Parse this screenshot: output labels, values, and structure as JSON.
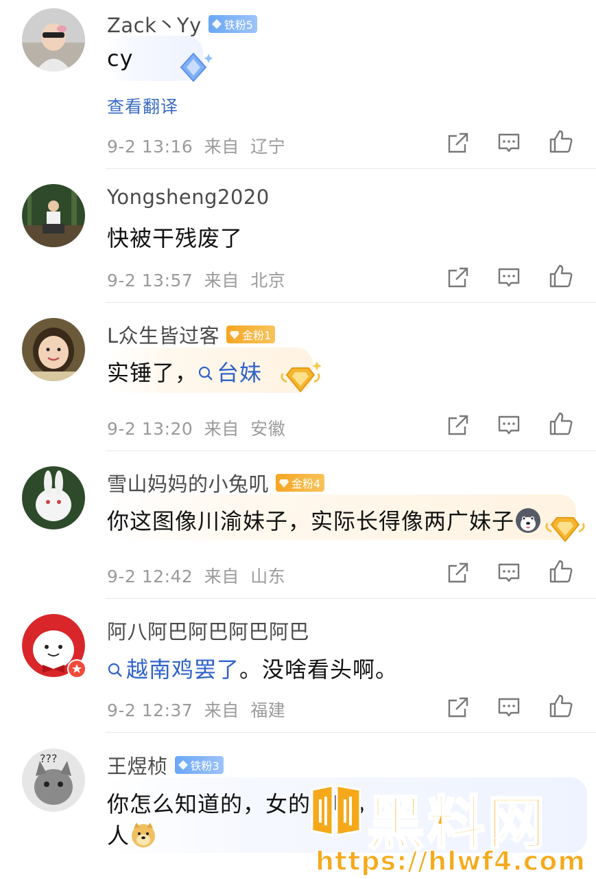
{
  "comments": [
    {
      "username": "Zack丶Yy",
      "badge": {
        "type": "iron",
        "label": "铁粉5"
      },
      "text": "cy",
      "translate": "查看翻译",
      "time": "9-2 13:16",
      "from": "来自",
      "location": "辽宁"
    },
    {
      "username": "Yongsheng2020",
      "text": "快被干残废了",
      "time": "9-2 13:57",
      "from": "来自",
      "location": "北京"
    },
    {
      "username": "L众生皆过客",
      "badge": {
        "type": "gold",
        "label": "金粉1"
      },
      "text": "实锤了，",
      "topic": "台妹",
      "time": "9-2 13:20",
      "from": "来自",
      "location": "安徽"
    },
    {
      "username": "雪山妈妈的小兔叽",
      "badge": {
        "type": "gold",
        "label": "金粉4"
      },
      "text": "你这图像川渝妹子，实际长得像两广妹子",
      "time": "9-2 12:42",
      "from": "来自",
      "location": "山东"
    },
    {
      "username": "阿八阿巴阿巴阿巴阿巴",
      "topic": "越南鸡罢了",
      "text": "。没啥看头啊。",
      "time": "9-2 12:37",
      "from": "来自",
      "location": "福建"
    },
    {
      "username": "王煜桢",
      "badge": {
        "type": "iron",
        "label": "铁粉3"
      },
      "text": "你怎么知道的，女的叫啥，",
      "text_line2": "人"
    }
  ],
  "watermark": {
    "brand": "黑料网",
    "url": "https://hlwf4.com"
  },
  "colors": {
    "topic": "#2f62c9",
    "meta": "#9a9a9a",
    "iron_badge": "#6aa7f5",
    "gold_badge": "#f5a623",
    "watermark": "#f5a91a"
  },
  "icons": [
    "share-icon",
    "comment-icon",
    "like-icon",
    "search-icon",
    "diamond-icon"
  ]
}
